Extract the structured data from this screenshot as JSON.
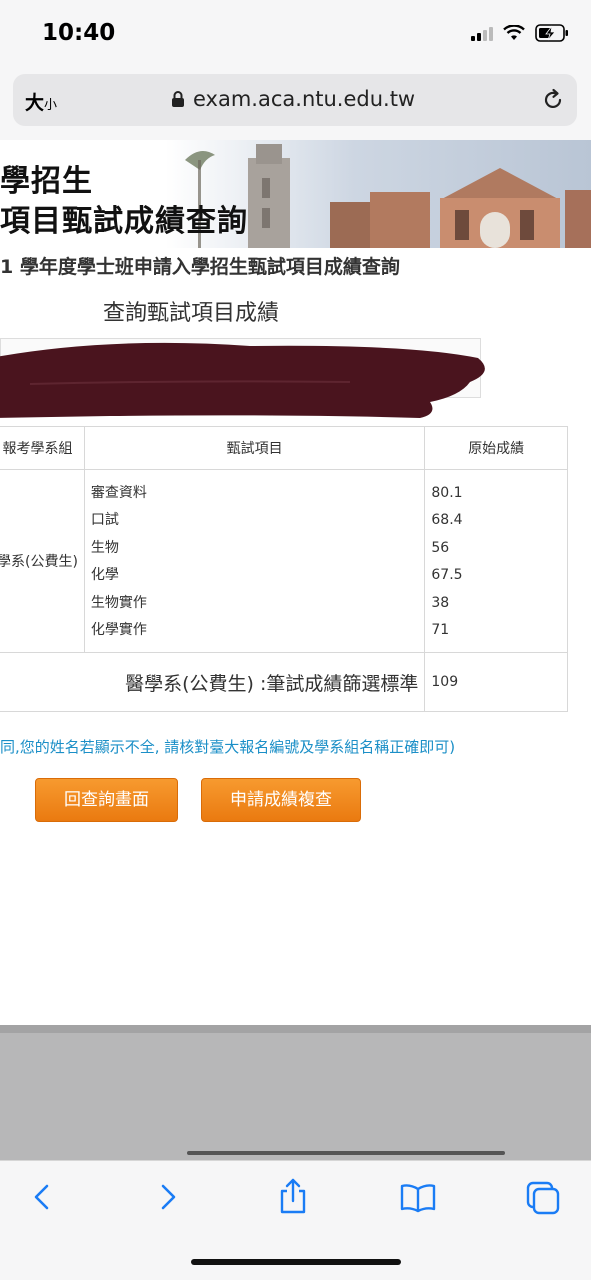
{
  "status": {
    "time": "10:40"
  },
  "browser": {
    "text_size_label": "大",
    "text_size_small": "小",
    "url": "exam.aca.ntu.edu.tw"
  },
  "banner": {
    "title_line1": "學招生",
    "title_line2": "項目甄試成績查詢"
  },
  "page": {
    "subtitle": "1 學年度學士班申請入學招生甄試項目成績查詢",
    "section_title": "查詢甄試項目成績",
    "table": {
      "headers": [
        "報考學系組",
        "甄試項目",
        "原始成績"
      ],
      "department": "學系(公費生)",
      "items": [
        {
          "name": "審查資料",
          "score": "80.1"
        },
        {
          "name": "口試",
          "score": "68.4"
        },
        {
          "name": "生物",
          "score": "56"
        },
        {
          "name": "化學",
          "score": "67.5"
        },
        {
          "name": "生物實作",
          "score": "38"
        },
        {
          "name": "化學實作",
          "score": "71"
        }
      ],
      "standard_label": "醫學系(公費生) :筆試成績篩選標準",
      "standard_value": "109"
    },
    "notice": "同,您的姓名若顯示不全, 請核對臺大報名編號及學系組名稱正確即可)",
    "buttons": {
      "back": "回查詢畫面",
      "review": "申請成績複查"
    }
  },
  "colors": {
    "button": "#f08a1e",
    "notice": "#1b8fc7",
    "redaction": "#4a141e"
  },
  "icons": [
    "lock-icon",
    "reload-icon",
    "back-icon",
    "forward-icon",
    "share-icon",
    "bookmarks-icon",
    "tabs-icon"
  ]
}
